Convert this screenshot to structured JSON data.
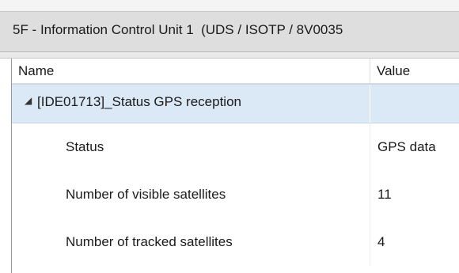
{
  "window": {
    "title": "5F - Information Control Unit 1  (UDS / ISOTP / 8V0035"
  },
  "grid": {
    "columns": {
      "name": "Name",
      "value": "Value"
    },
    "group": {
      "expander_icon": "triangle-expanded-icon",
      "expander_glyph": "◢",
      "label": "[IDE01713]_Status GPS reception"
    },
    "rows": [
      {
        "name": "Status",
        "value": "GPS data"
      },
      {
        "name": "Number of visible satellites",
        "value": "11"
      },
      {
        "name": "Number of tracked satellites",
        "value": "4"
      }
    ]
  }
}
